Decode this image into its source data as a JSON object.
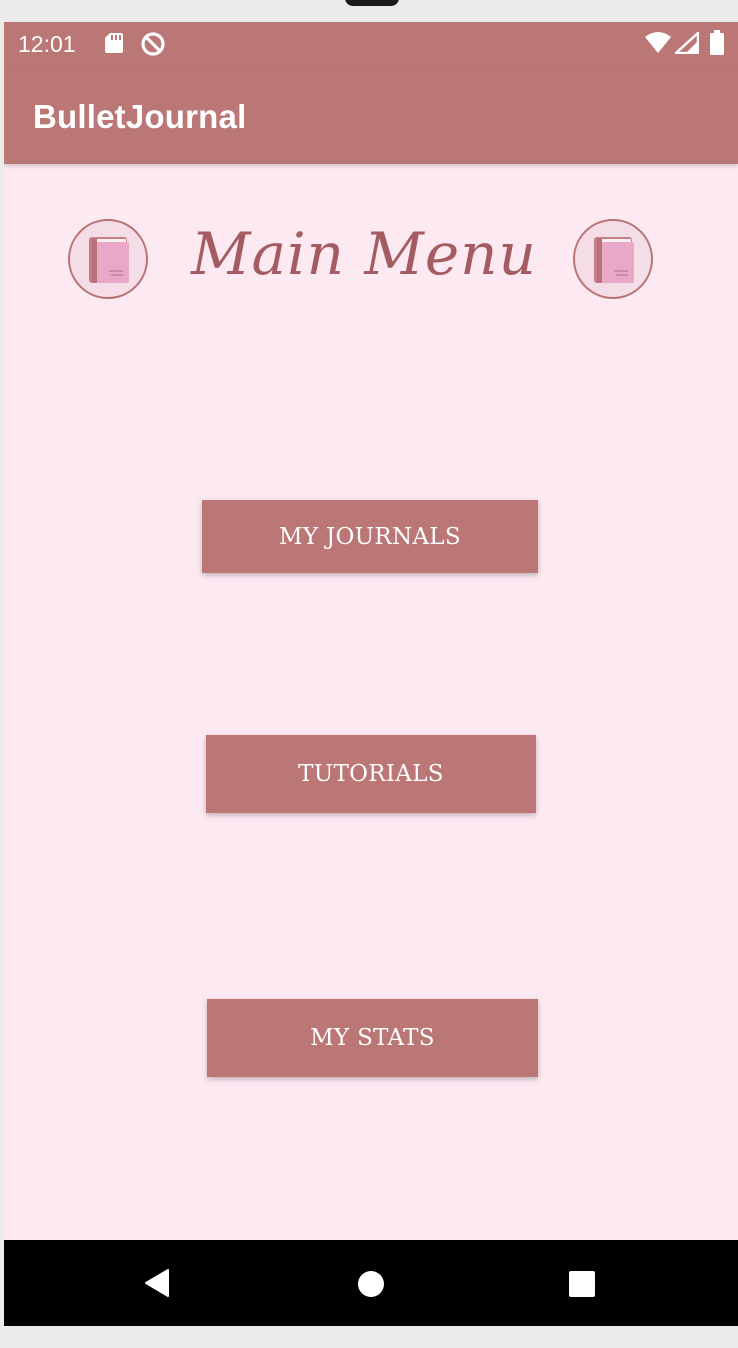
{
  "status_bar": {
    "time": "12:01",
    "icons": [
      "sd-card-icon",
      "data-saver-icon",
      "wifi-icon",
      "signal-icon",
      "battery-icon"
    ]
  },
  "app_bar": {
    "title": "BulletJournal"
  },
  "main": {
    "title": "Main Menu",
    "buttons": [
      {
        "label": "MY JOURNALS"
      },
      {
        "label": "TUTORIALS"
      },
      {
        "label": "MY STATS"
      }
    ]
  },
  "nav_bar": {
    "icons": [
      "back-icon",
      "home-icon",
      "recents-icon"
    ]
  },
  "colors": {
    "accent": "#bb7676",
    "background": "#fce9f2",
    "title": "#a45b61"
  }
}
